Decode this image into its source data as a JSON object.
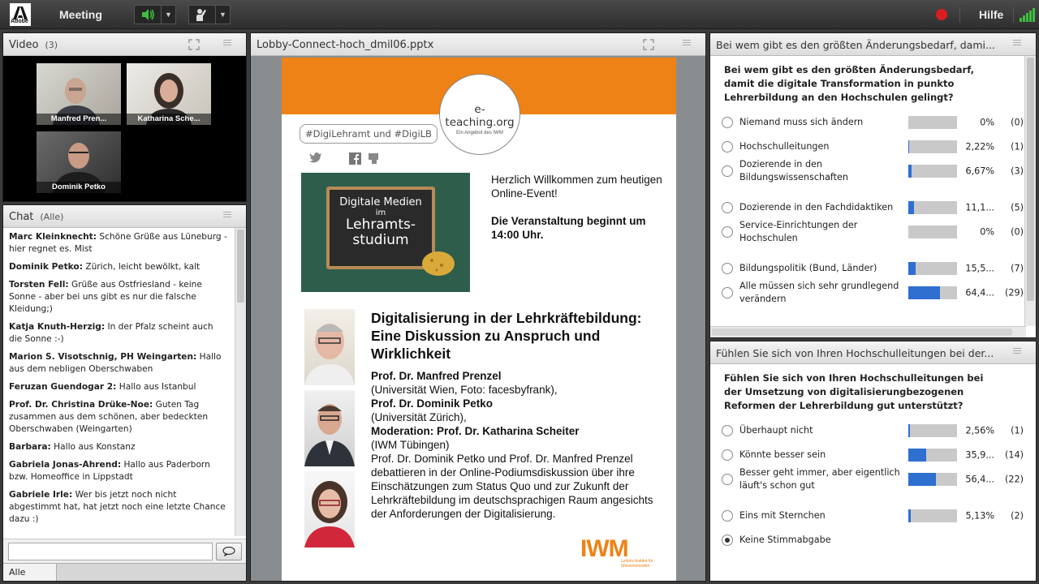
{
  "topbar": {
    "logo_text": "Adobe",
    "meeting_label": "Meeting",
    "help_label": "Hilfe",
    "accent": "#e02020"
  },
  "video": {
    "title": "Video",
    "count": "(3)",
    "participants": [
      {
        "name": "Manfred Pren..."
      },
      {
        "name": "Katharina Sche..."
      },
      {
        "name": "Dominik Petko"
      }
    ]
  },
  "chat": {
    "title": "Chat",
    "scope": "(Alle)",
    "messages": [
      {
        "sender": "Marc Kleinknecht:",
        "text": "Schöne Grüße aus Lüneburg - hier regnet es. Mist"
      },
      {
        "sender": "Dominik Petko:",
        "text": "Zürich, leicht bewölkt, kalt"
      },
      {
        "sender": "Torsten Fell:",
        "text": "Grüße aus Ostfriesland - keine Sonne - aber bei uns gibt es nur die falsche Kleidung;)"
      },
      {
        "sender": "Katja Knuth-Herzig:",
        "text": "In der Pfalz scheint auch die Sonne :-)"
      },
      {
        "sender": "Marion S. Visotschnig, PH Weingarten:",
        "text": "Hallo aus dem nebligen Oberschwaben"
      },
      {
        "sender": "Feruzan Guendogar 2:",
        "text": "Hallo aus Istanbul"
      },
      {
        "sender": "Prof. Dr. Christina Drüke-Noe:",
        "text": "Guten Tag zusammen aus dem schönen, aber bedeckten Oberschwaben (Weingarten)"
      },
      {
        "sender": "Barbara:",
        "text": "Hallo aus Konstanz"
      },
      {
        "sender": "Gabriela Jonas-Ahrend:",
        "text": "Hallo aus Paderborn bzw. Homeoffice in Lippstadt"
      },
      {
        "sender": "Gabriele Irle:",
        "text": "Wer bis jetzt noch nicht abgestimmt hat, hat jetzt noch eine letzte Chance dazu :)"
      }
    ],
    "input_value": "",
    "tab_label": "Alle"
  },
  "share": {
    "title": "Lobby-Connect-hoch_dmil06.pptx",
    "slide": {
      "logo_main": "e-teaching.org",
      "logo_sub": "Ein Angebot des IWM",
      "hashtags": "#DigiLehramt und #DigiLB",
      "board_line1": "Digitale Medien",
      "board_line2": "im",
      "board_line3": "Lehramts-",
      "board_line4": "studium",
      "welcome_line1": "Herzlich Willkommen zum heutigen Online-Event!",
      "welcome_line2": "Die Veranstaltung beginnt um 14:00 Uhr.",
      "heading": "Digitalisierung in der Lehrkräftebildung: Eine Diskussion zu Anspruch und Wirklichkeit",
      "p1_name": "Prof. Dr. Manfred Prenzel",
      "p1_aff": "(Universität Wien, Foto: facesbyfrank),",
      "p2_name": "Prof. Dr. Dominik Petko",
      "p2_aff": "(Universität Zürich),",
      "p3_name": "Moderation: Prof. Dr. Katharina Scheiter",
      "p3_aff": "(IWM Tübingen)",
      "description": "Prof. Dr. Dominik Petko und Prof. Dr. Manfred Prenzel debattieren in der Online-Podiumsdiskussion über ihre Einschätzungen zum Status Quo und zur Zukunft der Lehrkräftebildung im deutschsprachigen Raum angesichts der Anforderungen der Digitalisierung.",
      "iwm_logo": "IWM",
      "iwm_sub1": "Leibniz-Institut für",
      "iwm_sub2": "Wissensmedien",
      "orange": "#ef8216"
    }
  },
  "poll1": {
    "title": "Bei wem gibt es den größten Änderungsbedarf, dami...",
    "question": "Bei wem gibt es den größten Änderungsbedarf, damit die digitale Transformation in punkto Lehrerbildung an den Hochschulen gelingt?",
    "options": [
      {
        "label": "Niemand muss sich ändern",
        "pct": "0%",
        "count": "(0)",
        "value": 0
      },
      {
        "label": "Hochschulleitungen",
        "pct": "2,22%",
        "count": "(1)",
        "value": 2.22
      },
      {
        "label": "Dozierende in den Bildungswissenschaften",
        "pct": "6,67%",
        "count": "(3)",
        "value": 6.67
      },
      {
        "label": "Dozierende in den Fachdidaktiken",
        "pct": "11,1...",
        "count": "(5)",
        "value": 11.1
      },
      {
        "label": "Service-Einrichtungen der Hochschulen",
        "pct": "0%",
        "count": "(0)",
        "value": 0
      },
      {
        "label": "Bildungspolitik (Bund, Länder)",
        "pct": "15,5...",
        "count": "(7)",
        "value": 15.5
      },
      {
        "label": "Alle müssen sich sehr grundlegend verändern",
        "pct": "64,4...",
        "count": "(29)",
        "value": 64.4
      }
    ]
  },
  "poll2": {
    "title": "Fühlen Sie sich von Ihren Hochschulleitungen bei der...",
    "question": "Fühlen Sie sich von Ihren Hochschulleitungen bei der Umsetzung von digitalisierungbezogenen Reformen der Lehrerbildung gut unterstützt?",
    "options": [
      {
        "label": "Überhaupt nicht",
        "pct": "2,56%",
        "count": "(1)",
        "value": 2.56,
        "has_bar": true
      },
      {
        "label": "Könnte besser sein",
        "pct": "35,9...",
        "count": "(14)",
        "value": 35.9,
        "has_bar": true
      },
      {
        "label": "Besser geht immer, aber eigentlich läuft's schon gut",
        "pct": "56,4...",
        "count": "(22)",
        "value": 56.4,
        "has_bar": true
      },
      {
        "label": "Eins mit Sternchen",
        "pct": "5,13%",
        "count": "(2)",
        "value": 5.13,
        "has_bar": true
      },
      {
        "label": "Keine Stimmabgabe",
        "pct": "",
        "count": "",
        "value": 0,
        "has_bar": false,
        "selected": true
      }
    ],
    "bar_color": "#2e6fd0"
  }
}
